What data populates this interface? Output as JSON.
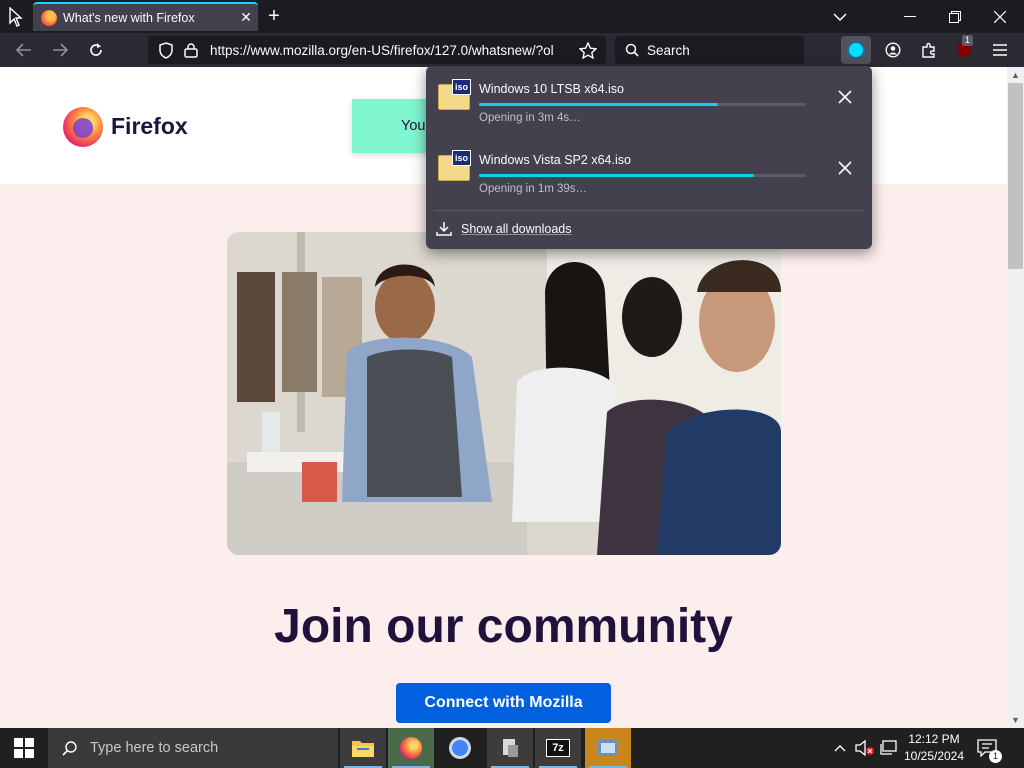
{
  "browser": {
    "tab_title": "What's new with Firefox",
    "url": "https://www.mozilla.org/en-US/firefox/127.0/whatsnew/?ol",
    "search_placeholder": "Search",
    "extension_badge": "1"
  },
  "page": {
    "brand": "Firefox",
    "banner_text": "You",
    "headline": "Join our community",
    "cta_label": "Connect with Mozilla"
  },
  "downloads": {
    "items": [
      {
        "name": "Windows 10 LTSB x64.iso",
        "status": "Opening in 3m 4s…",
        "progress": 0.73,
        "icon_label": "iso"
      },
      {
        "name": "Windows Vista SP2 x64.iso",
        "status": "Opening in 1m 39s…",
        "progress": 0.84,
        "icon_label": "iso"
      }
    ],
    "show_all_label": "Show all downloads"
  },
  "taskbar": {
    "search_placeholder": "Type here to search",
    "time": "12:12 PM",
    "date": "10/25/2024",
    "notification_count": "1",
    "app_7z_label": "7z"
  },
  "colors": {
    "accent": "#0060df",
    "progress": "#0dd3f0",
    "page_bg": "#fdeeee"
  }
}
